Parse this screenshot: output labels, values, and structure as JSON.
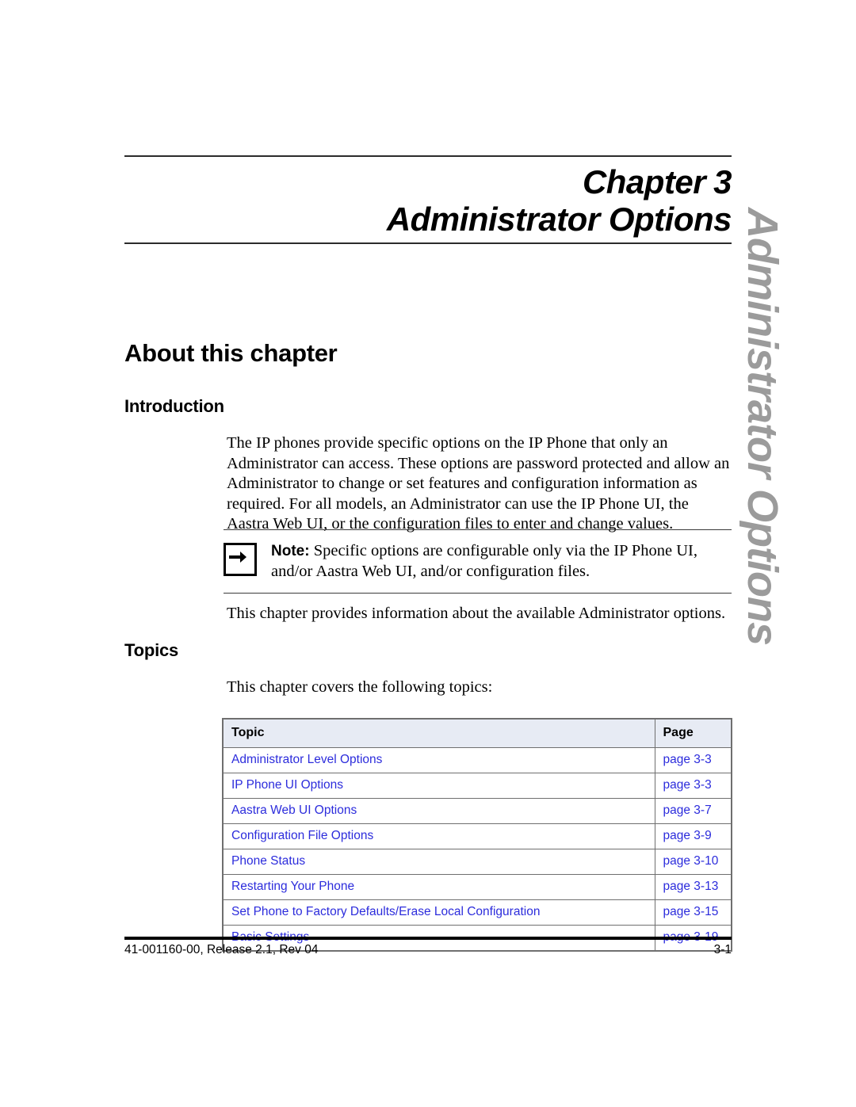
{
  "chapter": {
    "label": "Chapter",
    "number": "3",
    "title": "Administrator Options"
  },
  "side_tab": {
    "text": "Administrator Options",
    "color": "#9b9b9b"
  },
  "sections": {
    "about_heading": "About this chapter",
    "introduction_heading": "Introduction",
    "introduction_paragraph": "The IP phones provide specific options on the IP Phone that only an Administrator can access. These options are password protected and allow an Administrator to change or set features and configuration information as required. For all models, an Administrator can use the IP Phone UI, the Aastra Web UI, or the configuration files to enter and change values.",
    "after_note_paragraph": "This chapter provides information about the available Administrator options.",
    "topics_heading": "Topics",
    "topics_intro": "This chapter covers the following topics:"
  },
  "note": {
    "icon": "right-arrow-icon",
    "label": "Note:",
    "text": "Specific options are configurable only via the IP Phone UI, and/or Aastra Web UI, and/or configuration files."
  },
  "topics_table": {
    "headers": [
      "Topic",
      "Page"
    ],
    "header_bg": "#e7ebf4",
    "link_color": "#2c2cdc",
    "rows": [
      {
        "topic": "Administrator Level Options",
        "page": "page 3-3",
        "indent": 0
      },
      {
        "topic": "IP Phone UI Options",
        "page": "page 3-3",
        "indent": 1
      },
      {
        "topic": "Aastra Web UI Options",
        "page": "page 3-7",
        "indent": 1
      },
      {
        "topic": "Configuration File Options",
        "page": "page 3-9",
        "indent": 1
      },
      {
        "topic": "Phone Status",
        "page": "page 3-10",
        "indent": 1
      },
      {
        "topic": "Restarting Your Phone",
        "page": "page 3-13",
        "indent": 1
      },
      {
        "topic": "Set Phone to Factory Defaults/Erase Local Configuration",
        "page": "page 3-15",
        "indent": 1
      },
      {
        "topic": "Basic Settings",
        "page": "page 3-19",
        "indent": 1
      }
    ]
  },
  "footer": {
    "left": "41-001160-00, Release 2.1, Rev 04",
    "right": "3-1"
  }
}
